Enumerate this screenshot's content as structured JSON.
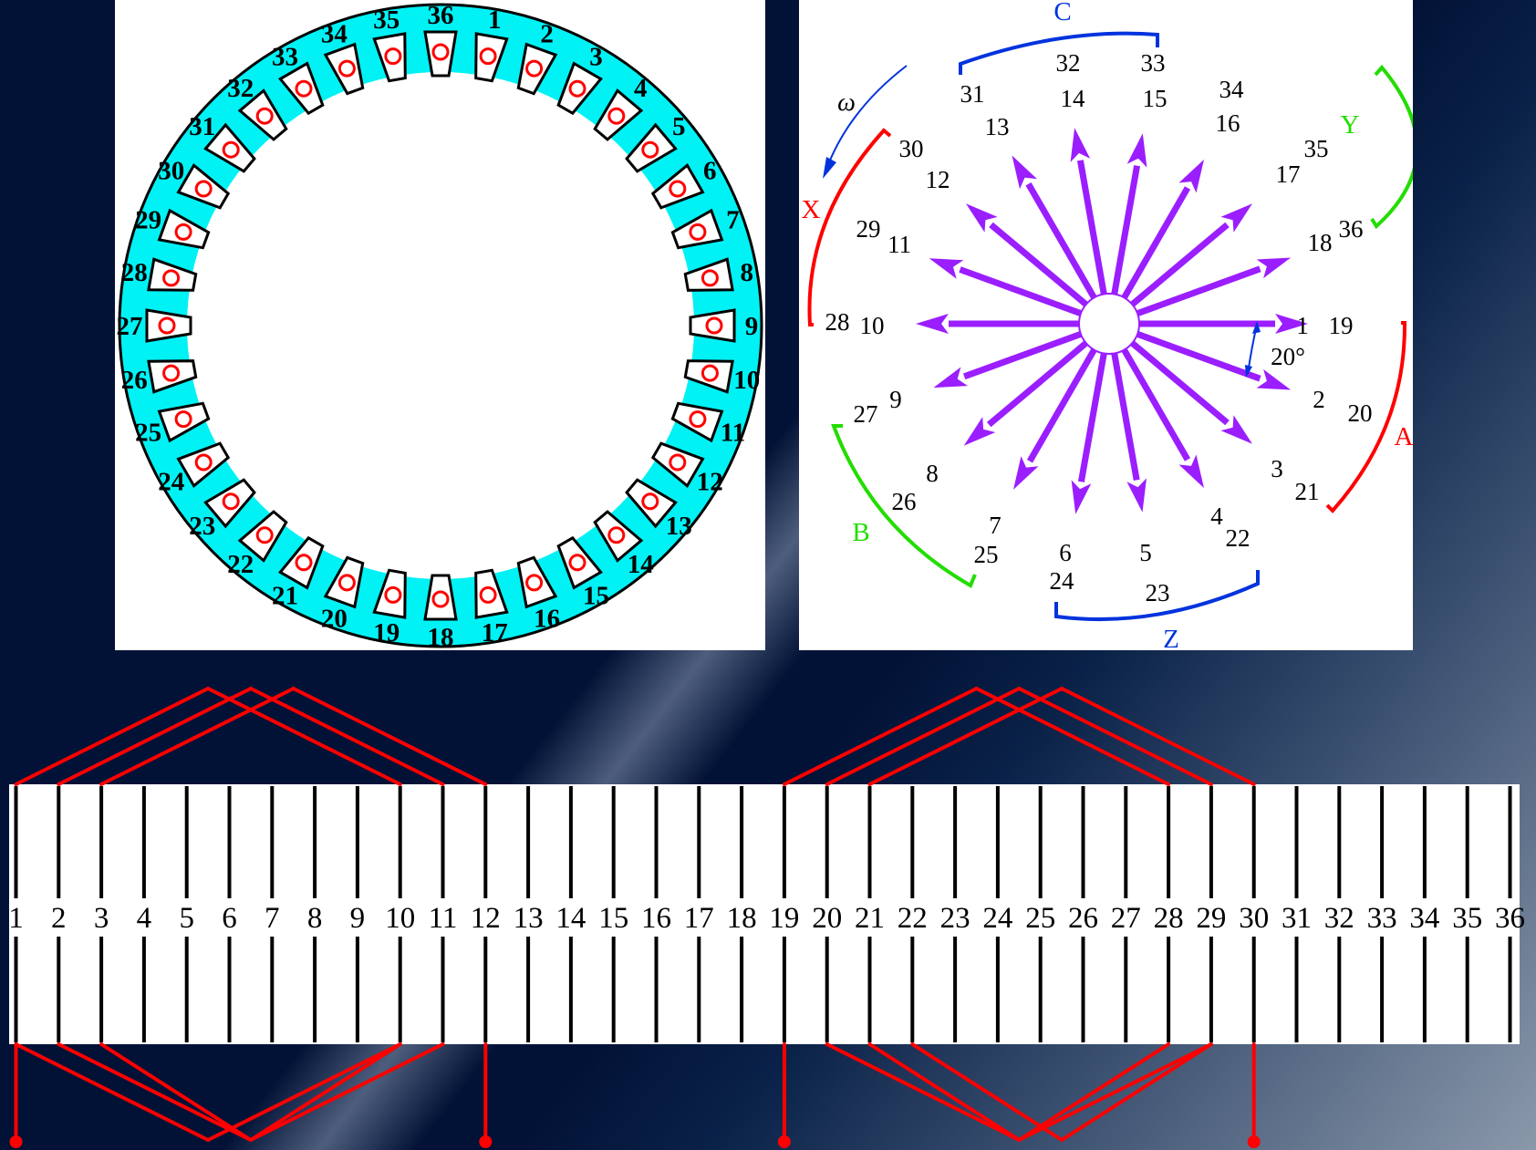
{
  "stator": {
    "slot_count": 36,
    "slot_labels": [
      "1",
      "2",
      "3",
      "4",
      "5",
      "6",
      "7",
      "8",
      "9",
      "10",
      "11",
      "12",
      "13",
      "14",
      "15",
      "16",
      "17",
      "18",
      "19",
      "20",
      "21",
      "22",
      "23",
      "24",
      "25",
      "26",
      "27",
      "28",
      "29",
      "30",
      "31",
      "32",
      "33",
      "34",
      "35",
      "36"
    ],
    "yoke_color": "#00F2F5",
    "conductor_color": "#FF0000"
  },
  "phasor": {
    "omega_label": "ω",
    "angle_label": "20°",
    "spoke_color": "#9B1EFF",
    "labels": {
      "a1": [
        "1",
        "19"
      ],
      "a2": [
        "2",
        "20"
      ],
      "a3": [
        "3",
        "21"
      ],
      "a4": [
        "4",
        "22"
      ],
      "a5": [
        "5",
        "23"
      ],
      "a6": [
        "6",
        "24"
      ],
      "a7": [
        "7",
        "25"
      ],
      "a8": [
        "8",
        "26"
      ],
      "a9": [
        "9",
        "27"
      ],
      "a10": [
        "10",
        "28"
      ],
      "a11": [
        "11",
        "29"
      ],
      "a12": [
        "12",
        "30"
      ],
      "a13": [
        "13",
        "31"
      ],
      "a14": [
        "14",
        "32"
      ],
      "a15": [
        "15",
        "33"
      ],
      "a16": [
        "16",
        "34"
      ],
      "a17": [
        "17",
        "35"
      ],
      "a18": [
        "18",
        "36"
      ]
    },
    "phases": [
      {
        "name": "A",
        "color": "#FF0000"
      },
      {
        "name": "Z",
        "color": "#0033DD"
      },
      {
        "name": "B",
        "color": "#22DD00"
      },
      {
        "name": "X",
        "color": "#FF0000"
      },
      {
        "name": "C",
        "color": "#0033DD"
      },
      {
        "name": "Y",
        "color": "#22DD00"
      }
    ]
  },
  "winding": {
    "slot_labels": [
      "1",
      "2",
      "3",
      "4",
      "5",
      "6",
      "7",
      "8",
      "9",
      "10",
      "11",
      "12",
      "13",
      "14",
      "15",
      "16",
      "17",
      "18",
      "19",
      "20",
      "21",
      "22",
      "23",
      "24",
      "25",
      "26",
      "27",
      "28",
      "29",
      "30",
      "31",
      "32",
      "33",
      "34",
      "35",
      "36"
    ],
    "coil_color": "#FF0000"
  }
}
